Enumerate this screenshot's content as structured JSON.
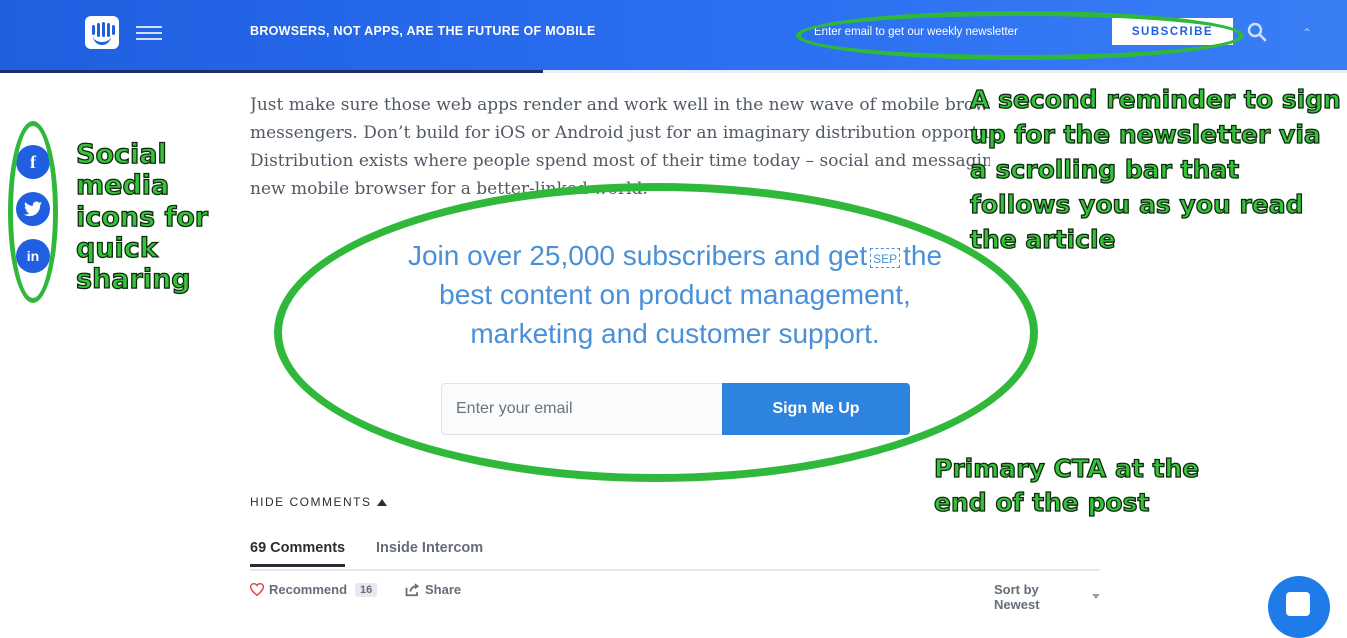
{
  "header": {
    "title": "BROWSERS, NOT APPS, ARE THE FUTURE OF MOBILE",
    "newsletter_placeholder": "Enter email to get our weekly newsletter",
    "subscribe_label": "SUBSCRIBE",
    "reading_progress": 0.403
  },
  "article": {
    "lines": [
      "Just make sure those web apps render and work well in the new wave of mobile browsers",
      "messengers. Don’t build for iOS or Android just for an imaginary distribution opportunity",
      "Distribution exists where people spend most of their time today – social and messaging",
      "new mobile browser for a better-linked world."
    ]
  },
  "cta": {
    "heading_part1": "Join over 25,000 subscribers and get",
    "sep_glyph": "SEP",
    "heading_part2": "the best content on product management, marketing and customer support.",
    "email_placeholder": "Enter your email",
    "button_label": "Sign Me Up"
  },
  "comments": {
    "hide_label": "HIDE COMMENTS",
    "tabs": [
      "69 Comments",
      "Inside Intercom"
    ],
    "recommend_label": "Recommend",
    "recommend_count": "16",
    "share_label": "Share",
    "sort_label": "Sort by Newest"
  },
  "social": {
    "icons": [
      "facebook-icon",
      "twitter-icon",
      "linkedin-icon"
    ],
    "facebook_glyph": "f",
    "linkedin_glyph": "in"
  },
  "annotations": {
    "social": "Social media icons for quick sharing",
    "newsletter": "A second reminder to sign up for the newsletter via a scrolling bar that follows you as you read the article",
    "cta": "Primary CTA at the end of the post"
  },
  "colors": {
    "brand_blue": "#1f5fe0",
    "cta_text": "#4a90d9",
    "cta_button": "#2d83dd",
    "annotation_green": "#38c23b"
  }
}
